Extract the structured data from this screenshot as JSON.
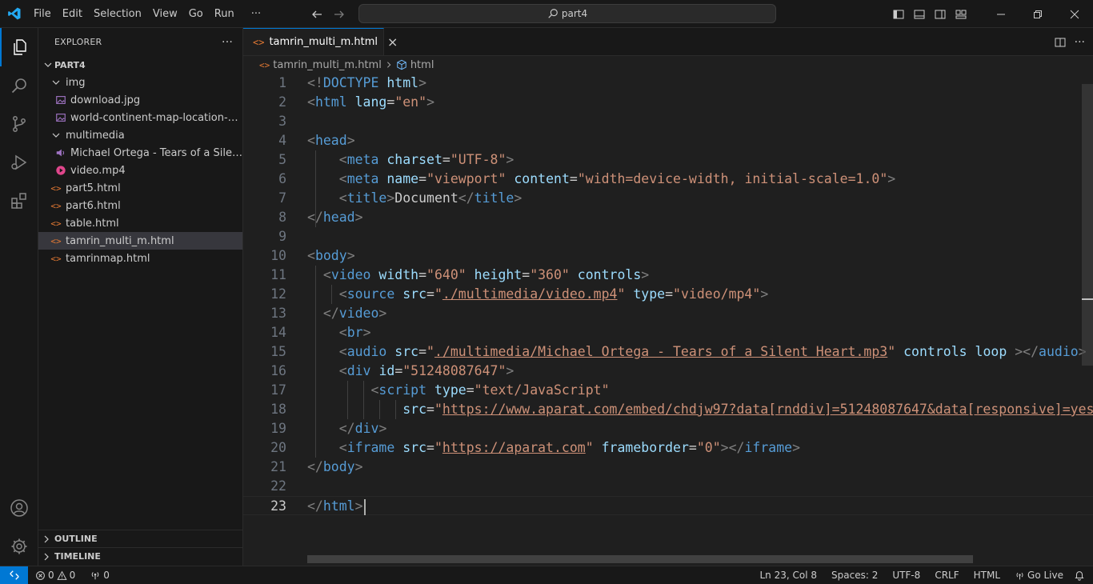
{
  "menu": [
    "File",
    "Edit",
    "Selection",
    "View",
    "Go",
    "Run",
    "···"
  ],
  "command_center": {
    "label": "part4",
    "icon": "search-icon"
  },
  "sidebar": {
    "title": "EXPLORER",
    "more": "···",
    "root": "PART4",
    "tree": [
      {
        "label": "img",
        "type": "folder",
        "depth": 1
      },
      {
        "label": "download.jpg",
        "type": "image",
        "depth": 2
      },
      {
        "label": "world-continent-map-location-gra...",
        "type": "image",
        "depth": 2
      },
      {
        "label": "multimedia",
        "type": "folder",
        "depth": 1
      },
      {
        "label": "Michael Ortega - Tears of a Silent H...",
        "type": "audio",
        "depth": 2
      },
      {
        "label": "video.mp4",
        "type": "video",
        "depth": 2
      },
      {
        "label": "part5.html",
        "type": "html",
        "depth": 1
      },
      {
        "label": "part6.html",
        "type": "html",
        "depth": 1
      },
      {
        "label": "table.html",
        "type": "html",
        "depth": 1
      },
      {
        "label": "tamrin_multi_m.html",
        "type": "html",
        "depth": 1,
        "selected": true
      },
      {
        "label": "tamrinmap.html",
        "type": "html",
        "depth": 1
      }
    ],
    "outline": "OUTLINE",
    "timeline": "TIMELINE"
  },
  "editor": {
    "tab": {
      "label": "tamrin_multi_m.html",
      "close": "×"
    },
    "breadcrumb": [
      "tamrin_multi_m.html",
      "html"
    ],
    "current_line": 23,
    "lines": [
      [
        [
          "br",
          "<!"
        ],
        [
          "tag",
          "DOCTYPE"
        ],
        [
          "txt",
          " "
        ],
        [
          "attr",
          "html"
        ],
        [
          "br",
          ">"
        ]
      ],
      [
        [
          "br",
          "<"
        ],
        [
          "tag",
          "html"
        ],
        [
          "txt",
          " "
        ],
        [
          "attr",
          "lang"
        ],
        [
          "txt",
          "="
        ],
        [
          "str",
          "\"en\""
        ],
        [
          "br",
          ">"
        ]
      ],
      [],
      [
        [
          "br",
          "<"
        ],
        [
          "tag",
          "head"
        ],
        [
          "br",
          ">"
        ]
      ],
      [
        [
          "txt",
          "    "
        ],
        [
          "br",
          "<"
        ],
        [
          "tag",
          "meta"
        ],
        [
          "txt",
          " "
        ],
        [
          "attr",
          "charset"
        ],
        [
          "txt",
          "="
        ],
        [
          "str",
          "\"UTF-8\""
        ],
        [
          "br",
          ">"
        ]
      ],
      [
        [
          "txt",
          "    "
        ],
        [
          "br",
          "<"
        ],
        [
          "tag",
          "meta"
        ],
        [
          "txt",
          " "
        ],
        [
          "attr",
          "name"
        ],
        [
          "txt",
          "="
        ],
        [
          "str",
          "\"viewport\""
        ],
        [
          "txt",
          " "
        ],
        [
          "attr",
          "content"
        ],
        [
          "txt",
          "="
        ],
        [
          "str",
          "\"width=device-width, initial-scale=1.0\""
        ],
        [
          "br",
          ">"
        ]
      ],
      [
        [
          "txt",
          "    "
        ],
        [
          "br",
          "<"
        ],
        [
          "tag",
          "title"
        ],
        [
          "br",
          ">"
        ],
        [
          "txt",
          "Document"
        ],
        [
          "br",
          "</"
        ],
        [
          "tag",
          "title"
        ],
        [
          "br",
          ">"
        ]
      ],
      [
        [
          "br",
          "</"
        ],
        [
          "tag",
          "head"
        ],
        [
          "br",
          ">"
        ]
      ],
      [],
      [
        [
          "br",
          "<"
        ],
        [
          "tag",
          "body"
        ],
        [
          "br",
          ">"
        ]
      ],
      [
        [
          "txt",
          "  "
        ],
        [
          "br",
          "<"
        ],
        [
          "tag",
          "video"
        ],
        [
          "txt",
          " "
        ],
        [
          "attr",
          "width"
        ],
        [
          "txt",
          "="
        ],
        [
          "str",
          "\"640\""
        ],
        [
          "txt",
          " "
        ],
        [
          "attr",
          "height"
        ],
        [
          "txt",
          "="
        ],
        [
          "str",
          "\"360\""
        ],
        [
          "txt",
          " "
        ],
        [
          "attr",
          "controls"
        ],
        [
          "br",
          ">"
        ]
      ],
      [
        [
          "txt",
          "    "
        ],
        [
          "br",
          "<"
        ],
        [
          "tag",
          "source"
        ],
        [
          "txt",
          " "
        ],
        [
          "attr",
          "src"
        ],
        [
          "txt",
          "="
        ],
        [
          "str",
          "\""
        ],
        [
          "link",
          "./multimedia/video.mp4"
        ],
        [
          "str",
          "\""
        ],
        [
          "txt",
          " "
        ],
        [
          "attr",
          "type"
        ],
        [
          "txt",
          "="
        ],
        [
          "str",
          "\"video/mp4\""
        ],
        [
          "br",
          ">"
        ]
      ],
      [
        [
          "txt",
          "  "
        ],
        [
          "br",
          "</"
        ],
        [
          "tag",
          "video"
        ],
        [
          "br",
          ">"
        ]
      ],
      [
        [
          "txt",
          "    "
        ],
        [
          "br",
          "<"
        ],
        [
          "tag",
          "br"
        ],
        [
          "br",
          ">"
        ]
      ],
      [
        [
          "txt",
          "    "
        ],
        [
          "br",
          "<"
        ],
        [
          "tag",
          "audio"
        ],
        [
          "txt",
          " "
        ],
        [
          "attr",
          "src"
        ],
        [
          "txt",
          "="
        ],
        [
          "str",
          "\""
        ],
        [
          "link",
          "./multimedia/Michael Ortega - Tears of a Silent Heart.mp3"
        ],
        [
          "str",
          "\""
        ],
        [
          "txt",
          " "
        ],
        [
          "attr",
          "controls"
        ],
        [
          "txt",
          " "
        ],
        [
          "attr",
          "loop"
        ],
        [
          "txt",
          " "
        ],
        [
          "br",
          "></"
        ],
        [
          "tag",
          "audio"
        ],
        [
          "br",
          ">"
        ]
      ],
      [
        [
          "txt",
          "    "
        ],
        [
          "br",
          "<"
        ],
        [
          "tag",
          "div"
        ],
        [
          "txt",
          " "
        ],
        [
          "attr",
          "id"
        ],
        [
          "txt",
          "="
        ],
        [
          "str",
          "\"51248087647\""
        ],
        [
          "br",
          ">"
        ]
      ],
      [
        [
          "txt",
          "        "
        ],
        [
          "br",
          "<"
        ],
        [
          "tag",
          "script"
        ],
        [
          "txt",
          " "
        ],
        [
          "attr",
          "type"
        ],
        [
          "txt",
          "="
        ],
        [
          "str",
          "\"text/JavaScript\""
        ]
      ],
      [
        [
          "txt",
          "            "
        ],
        [
          "attr",
          "src"
        ],
        [
          "txt",
          "="
        ],
        [
          "str",
          "\""
        ],
        [
          "link",
          "https://www.aparat.com/embed/chdjw97?data[rnddiv]=51248087647&data[responsive]=yes"
        ]
      ],
      [
        [
          "txt",
          "    "
        ],
        [
          "br",
          "</"
        ],
        [
          "tag",
          "div"
        ],
        [
          "br",
          ">"
        ]
      ],
      [
        [
          "txt",
          "    "
        ],
        [
          "br",
          "<"
        ],
        [
          "tag",
          "iframe"
        ],
        [
          "txt",
          " "
        ],
        [
          "attr",
          "src"
        ],
        [
          "txt",
          "="
        ],
        [
          "str",
          "\""
        ],
        [
          "link",
          "https://aparat.com"
        ],
        [
          "str",
          "\""
        ],
        [
          "txt",
          " "
        ],
        [
          "attr",
          "frameborder"
        ],
        [
          "txt",
          "="
        ],
        [
          "str",
          "\"0\""
        ],
        [
          "br",
          "></"
        ],
        [
          "tag",
          "iframe"
        ],
        [
          "br",
          ">"
        ]
      ],
      [
        [
          "br",
          "</"
        ],
        [
          "tag",
          "body"
        ],
        [
          "br",
          ">"
        ]
      ],
      [],
      [
        [
          "br",
          "</"
        ],
        [
          "tag",
          "html"
        ],
        [
          "br",
          ">"
        ]
      ]
    ]
  },
  "statusbar": {
    "errors": "0",
    "warnings": "0",
    "ports": "0",
    "position": "Ln 23, Col 8",
    "spaces": "Spaces: 2",
    "encoding": "UTF-8",
    "eol": "CRLF",
    "language": "HTML",
    "golive": "Go Live"
  },
  "colors": {
    "accent": "#0078d4",
    "tag": "#569cd6",
    "attr": "#9cdcfe",
    "string": "#ce9178",
    "bracket": "#808080"
  }
}
